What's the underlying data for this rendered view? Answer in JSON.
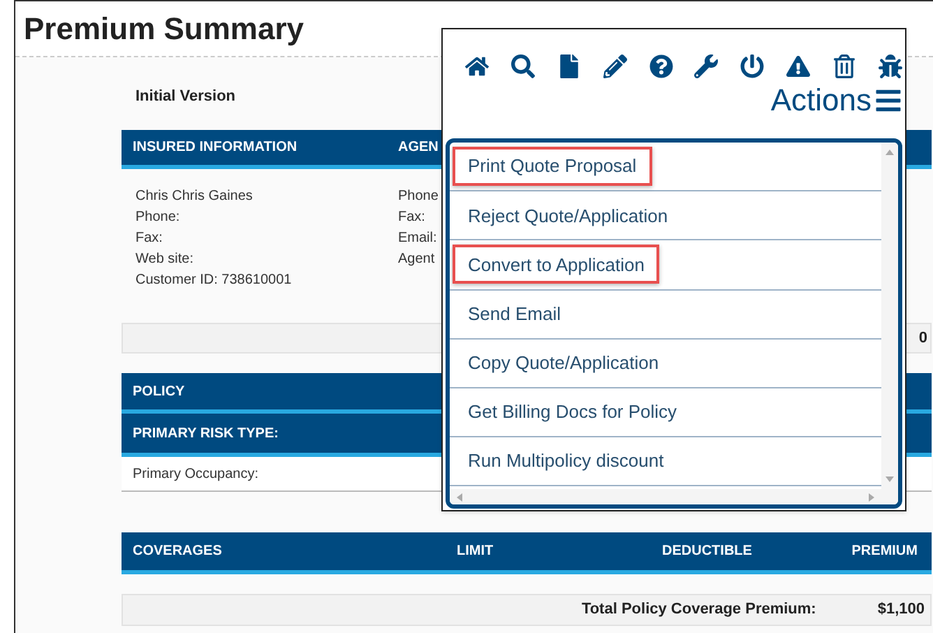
{
  "page_title": "Premium Summary",
  "version_label": "Initial Version",
  "insured_section": {
    "headers": [
      "INSURED INFORMATION",
      "AGEN"
    ],
    "insured_lines": [
      "Chris Chris Gaines",
      "Phone:",
      "Fax:",
      "Web site:",
      "Customer ID: 738610001"
    ],
    "agent_lines": [
      "Phone",
      "Fax:",
      "Email:",
      "Agent"
    ]
  },
  "summary_bar": {
    "value": "0"
  },
  "policy_section": {
    "header": "POLICY",
    "subheader": "PRIMARY RISK TYPE:",
    "rows": [
      "Primary Occupancy:"
    ]
  },
  "coverages_table": {
    "columns": [
      "COVERAGES",
      "LIMIT",
      "DEDUCTIBLE",
      "PREMIUM"
    ],
    "total_label": "Total Policy Coverage Premium:",
    "total_value": "$1,100"
  },
  "actions_popup": {
    "toolbar_icons": [
      {
        "kind": "home"
      },
      {
        "kind": "search"
      },
      {
        "kind": "file"
      },
      {
        "kind": "pencil"
      },
      {
        "kind": "help"
      },
      {
        "kind": "wrench"
      },
      {
        "kind": "power"
      },
      {
        "kind": "warning"
      },
      {
        "kind": "trash"
      },
      {
        "kind": "bug"
      }
    ],
    "title": "Actions",
    "items": [
      {
        "label": "Print Quote Proposal",
        "highlighted": true
      },
      {
        "label": "Reject Quote/Application",
        "highlighted": false
      },
      {
        "label": "Convert to Application",
        "highlighted": true
      },
      {
        "label": "Send Email",
        "highlighted": false
      },
      {
        "label": "Copy Quote/Application",
        "highlighted": false
      },
      {
        "label": "Get Billing Docs for Policy",
        "highlighted": false
      },
      {
        "label": "Run Multipolicy discount",
        "highlighted": false
      }
    ]
  }
}
